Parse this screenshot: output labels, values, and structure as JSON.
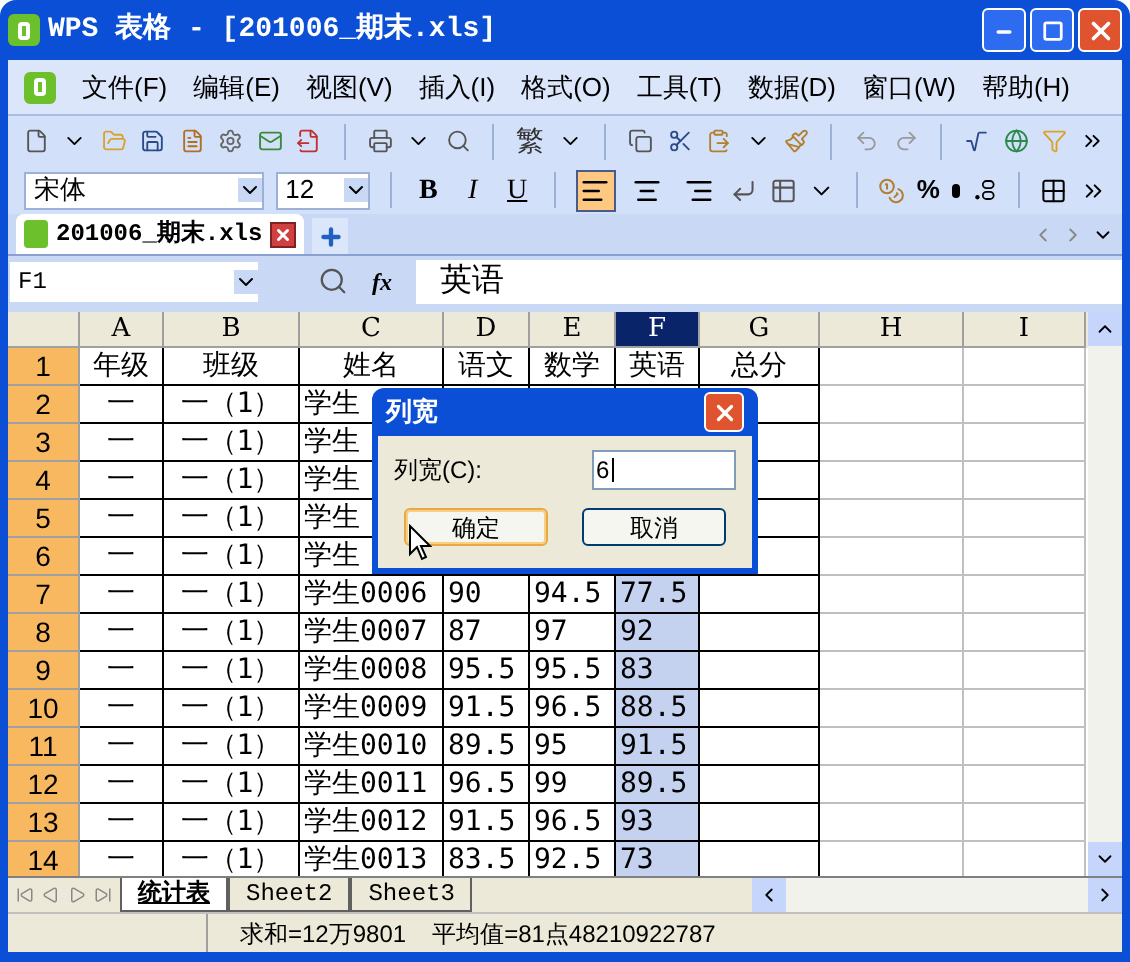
{
  "window": {
    "title": "WPS 表格 - [201006_期末.xls]"
  },
  "menu": [
    "文件(F)",
    "编辑(E)",
    "视图(V)",
    "插入(I)",
    "格式(O)",
    "工具(T)",
    "数据(D)",
    "窗口(W)",
    "帮助(H)"
  ],
  "standard_toolbar": {
    "convert_label": "繁"
  },
  "format_toolbar": {
    "font": "宋体",
    "size": "12",
    "style_buttons": [
      "B",
      "I",
      "U"
    ],
    "align_buttons": [
      {
        "selected": true
      },
      {
        "selected": false
      },
      {
        "selected": false
      }
    ],
    "percent": "%"
  },
  "documents": [
    {
      "name": "201006_期末.xls",
      "selected": true
    }
  ],
  "formula_bar": {
    "cell": "F1",
    "function_label": "fx",
    "content": "英语"
  },
  "columns": [
    {
      "label": "A",
      "selected": false
    },
    {
      "label": "B",
      "selected": false
    },
    {
      "label": "C",
      "selected": false
    },
    {
      "label": "D",
      "selected": false
    },
    {
      "label": "E",
      "selected": false
    },
    {
      "label": "F",
      "selected": true
    },
    {
      "label": "G",
      "selected": false
    },
    {
      "label": "H",
      "selected": false
    },
    {
      "label": "I",
      "selected": false
    }
  ],
  "rows": [
    {
      "header": "1",
      "cells": [
        "年级",
        "班级",
        "姓名",
        "语文",
        "数学",
        "英语",
        "总分"
      ]
    },
    {
      "header": "2",
      "cells": [
        "一",
        "一（1）",
        "学生"
      ]
    },
    {
      "header": "3",
      "cells": [
        "一",
        "一（1）",
        "学生"
      ]
    },
    {
      "header": "4",
      "cells": [
        "一",
        "一（1）",
        "学生"
      ]
    },
    {
      "header": "5",
      "cells": [
        "一",
        "一（1）",
        "学生"
      ]
    },
    {
      "header": "6",
      "cells": [
        "一",
        "一（1）",
        "学生"
      ]
    },
    {
      "header": "7",
      "cells": [
        "一",
        "一（1）",
        "学生0006",
        "90",
        "94.5",
        "77.5"
      ]
    },
    {
      "header": "8",
      "cells": [
        "一",
        "一（1）",
        "学生0007",
        "87",
        "97",
        "92"
      ]
    },
    {
      "header": "9",
      "cells": [
        "一",
        "一（1）",
        "学生0008",
        "95.5",
        "95.5",
        "83"
      ]
    },
    {
      "header": "10",
      "cells": [
        "一",
        "一（1）",
        "学生0009",
        "91.5",
        "96.5",
        "88.5"
      ]
    },
    {
      "header": "11",
      "cells": [
        "一",
        "一（1）",
        "学生0010",
        "89.5",
        "95",
        "91.5"
      ]
    },
    {
      "header": "12",
      "cells": [
        "一",
        "一（1）",
        "学生0011",
        "96.5",
        "99",
        "89.5"
      ]
    },
    {
      "header": "13",
      "cells": [
        "一",
        "一（1）",
        "学生0012",
        "91.5",
        "96.5",
        "93"
      ]
    },
    {
      "header": "14",
      "cells": [
        "一",
        "一（1）",
        "学生0013",
        "83.5",
        "92.5",
        "73"
      ]
    }
  ],
  "sheets": [
    {
      "name": "统计表",
      "selected": true
    },
    {
      "name": "Sheet2",
      "selected": false
    },
    {
      "name": "Sheet3",
      "selected": false
    }
  ],
  "status_bar": {
    "sum": "求和=12万9801",
    "average": "平均值=81点48210922787"
  },
  "dialog": {
    "title": "列宽",
    "label": "列宽(C):",
    "value": "6",
    "buttons": [
      {
        "label": "确定",
        "default": true
      },
      {
        "label": "取消",
        "default": false
      }
    ]
  }
}
